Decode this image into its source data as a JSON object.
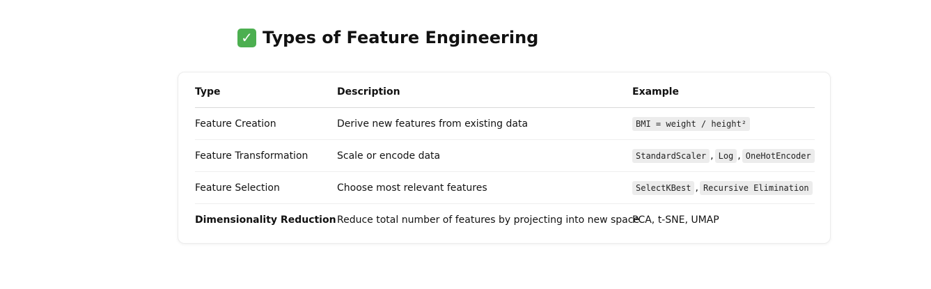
{
  "heading": {
    "icon": "check-mark-icon",
    "icon_glyph": "✓",
    "title": "Types of Feature Engineering"
  },
  "table": {
    "headers": [
      "Type",
      "Description",
      "Example"
    ],
    "rows": [
      {
        "type": "Feature Creation",
        "description": "Derive new features from existing data",
        "example_codes": [
          "BMI = weight / height²"
        ]
      },
      {
        "type": "Feature Transformation",
        "description": "Scale or encode data",
        "example_codes": [
          "StandardScaler",
          "Log",
          "OneHotEncoder"
        ]
      },
      {
        "type": "Feature Selection",
        "description": "Choose most relevant features",
        "example_codes": [
          "SelectKBest",
          "Recursive Elimination"
        ]
      },
      {
        "type": "Dimensionality Reduction",
        "description": "Reduce total number of features by projecting into new space",
        "example_text": "PCA, t-SNE, UMAP"
      }
    ],
    "separator": ","
  },
  "colors": {
    "icon_background": "#4caf50",
    "code_background": "#ececec",
    "text": "#111111"
  }
}
